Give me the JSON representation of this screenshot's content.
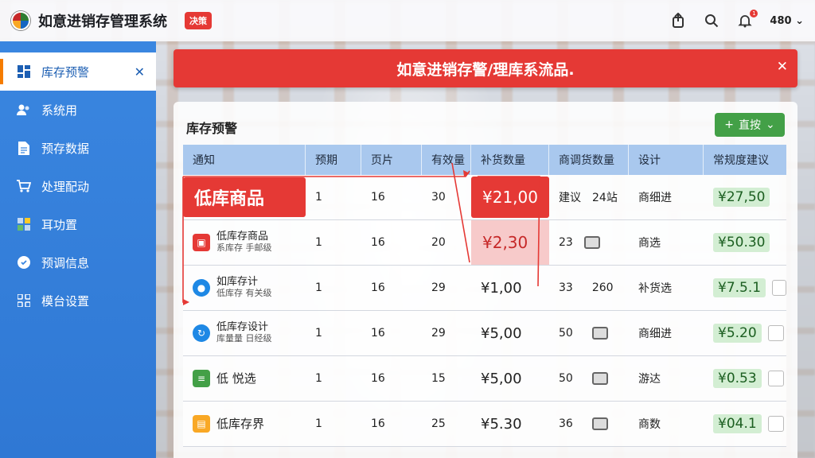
{
  "header": {
    "app_title": "如意进销存管理系统",
    "badge": "决策",
    "user": "480",
    "notif_count": "1"
  },
  "sidebar": {
    "items": [
      {
        "label": "库存预警",
        "icon": "dashboard-icon"
      },
      {
        "label": "系统用",
        "icon": "users-icon"
      },
      {
        "label": "预存数据",
        "icon": "document-icon"
      },
      {
        "label": "处理配动",
        "icon": "cart-icon"
      },
      {
        "label": "耳功置",
        "icon": "grid-icon"
      },
      {
        "label": "预调信息",
        "icon": "info-icon"
      },
      {
        "label": "模台设置",
        "icon": "apps-icon"
      }
    ]
  },
  "alert": {
    "text": "如意进销存警/理库系流品."
  },
  "card": {
    "title": "库存预警",
    "button": "直按"
  },
  "table": {
    "headers": [
      "通知",
      "预期",
      "页片",
      "有效量",
      "补货数量",
      "商调货数量",
      "设计",
      "常规度建议"
    ],
    "rows": [
      {
        "name": "低库商品",
        "sub": "",
        "c2": "1",
        "c3": "16",
        "c4": "30",
        "c5": "¥21,00",
        "c6a": "建议",
        "c6b": "24站",
        "c7": "商细进",
        "c8": "¥27,50"
      },
      {
        "name": "低库存商品",
        "sub": "系库存 手邮级",
        "c2": "1",
        "c3": "16",
        "c4": "20",
        "c5": "¥2,30",
        "c6a": "23",
        "c6b": "",
        "c7": "商选",
        "c8": "¥50.30"
      },
      {
        "name": "如库存计",
        "sub": "低库存 有关级",
        "c2": "1",
        "c3": "16",
        "c4": "29",
        "c5": "¥1,00",
        "c6a": "33",
        "c6b": "260",
        "c7": "补货选",
        "c8": "¥7.5.1"
      },
      {
        "name": "低库存设计",
        "sub": "库量量 日经级",
        "c2": "1",
        "c3": "16",
        "c4": "29",
        "c5": "¥5,00",
        "c6a": "50",
        "c6b": "",
        "c7": "商细进",
        "c8": "¥5.20"
      },
      {
        "name": "低 悦选",
        "sub": "",
        "c2": "1",
        "c3": "16",
        "c4": "15",
        "c5": "¥5,00",
        "c6a": "50",
        "c6b": "",
        "c7": "游达",
        "c8": "¥0.53"
      },
      {
        "name": "低库存界",
        "sub": "",
        "c2": "1",
        "c3": "16",
        "c4": "25",
        "c5": "¥5.30",
        "c6a": "36",
        "c6b": "",
        "c7": "商数",
        "c8": "¥04.1"
      }
    ]
  },
  "colors": {
    "accent": "#3a86e0",
    "danger": "#e53935",
    "success": "#43a047"
  }
}
